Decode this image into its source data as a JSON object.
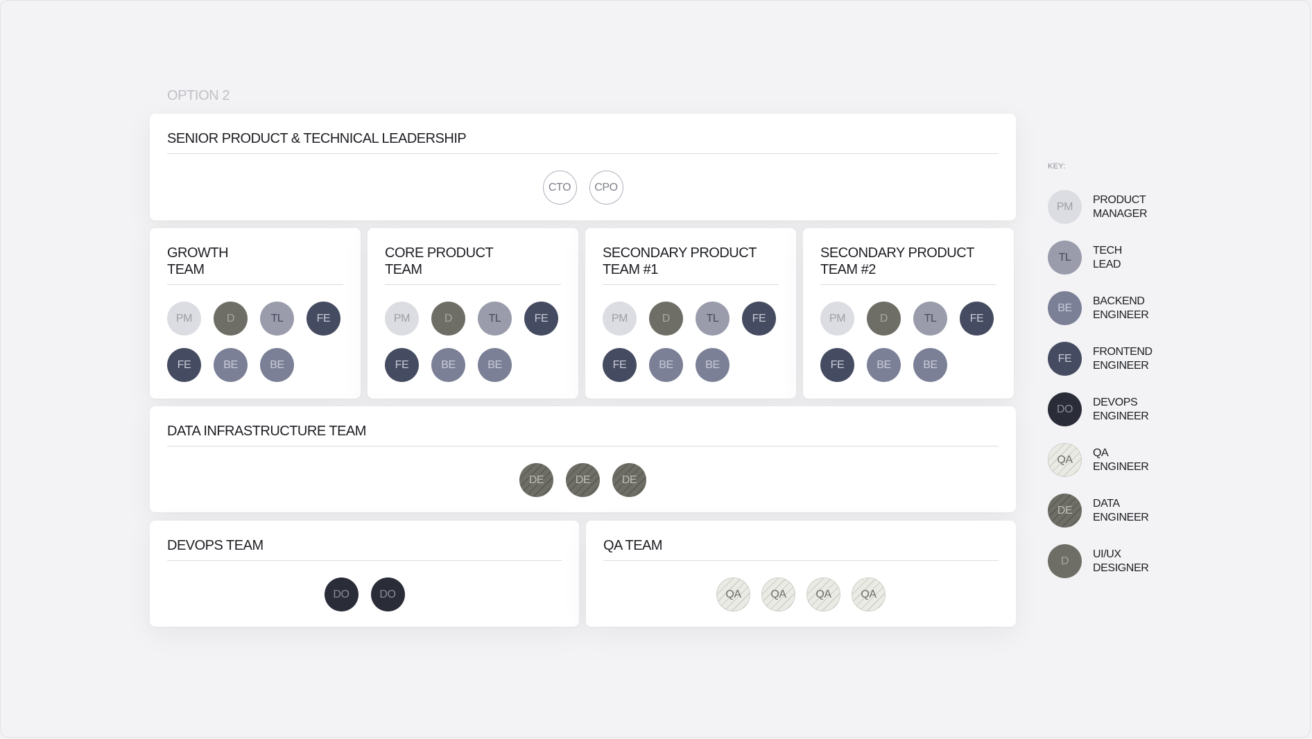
{
  "option_label": "OPTION 2",
  "leadership": {
    "title": "SENIOR PRODUCT & TECHNICAL LEADERSHIP",
    "members": [
      "CTO",
      "CPO"
    ]
  },
  "teams": [
    {
      "title": "GROWTH\nTEAM",
      "members": [
        {
          "role": "pm",
          "label": "PM"
        },
        {
          "role": "d",
          "label": "D"
        },
        {
          "role": "tl",
          "label": "TL"
        },
        {
          "role": "fe",
          "label": "FE"
        },
        {
          "role": "fe",
          "label": "FE"
        },
        {
          "role": "be",
          "label": "BE"
        },
        {
          "role": "be",
          "label": "BE"
        }
      ]
    },
    {
      "title": "CORE PRODUCT\nTEAM",
      "members": [
        {
          "role": "pm",
          "label": "PM"
        },
        {
          "role": "d",
          "label": "D"
        },
        {
          "role": "tl",
          "label": "TL"
        },
        {
          "role": "fe",
          "label": "FE"
        },
        {
          "role": "fe",
          "label": "FE"
        },
        {
          "role": "be",
          "label": "BE"
        },
        {
          "role": "be",
          "label": "BE"
        }
      ]
    },
    {
      "title": "SECONDARY PRODUCT\nTEAM #1",
      "members": [
        {
          "role": "pm",
          "label": "PM"
        },
        {
          "role": "d",
          "label": "D"
        },
        {
          "role": "tl",
          "label": "TL"
        },
        {
          "role": "fe",
          "label": "FE"
        },
        {
          "role": "fe",
          "label": "FE"
        },
        {
          "role": "be",
          "label": "BE"
        },
        {
          "role": "be",
          "label": "BE"
        }
      ]
    },
    {
      "title": "SECONDARY PRODUCT\nTEAM #2",
      "members": [
        {
          "role": "pm",
          "label": "PM"
        },
        {
          "role": "d",
          "label": "D"
        },
        {
          "role": "tl",
          "label": "TL"
        },
        {
          "role": "fe",
          "label": "FE"
        },
        {
          "role": "fe",
          "label": "FE"
        },
        {
          "role": "be",
          "label": "BE"
        },
        {
          "role": "be",
          "label": "BE"
        }
      ]
    }
  ],
  "data_infrastructure": {
    "title": "DATA INFRASTRUCTURE TEAM",
    "members": [
      "DE",
      "DE",
      "DE"
    ]
  },
  "devops": {
    "title": "DEVOPS TEAM",
    "members": [
      "DO",
      "DO"
    ]
  },
  "qa": {
    "title": "QA TEAM",
    "members": [
      "QA",
      "QA",
      "QA",
      "QA"
    ]
  },
  "key": {
    "title": "KEY:",
    "items": [
      {
        "role": "pm",
        "abbr": "PM",
        "label": "PRODUCT\nMANAGER"
      },
      {
        "role": "tl",
        "abbr": "TL",
        "label": "TECH\nLEAD"
      },
      {
        "role": "be",
        "abbr": "BE",
        "label": "BACKEND\nENGINEER"
      },
      {
        "role": "fe",
        "abbr": "FE",
        "label": "FRONTEND\nENGINEER"
      },
      {
        "role": "do",
        "abbr": "DO",
        "label": "DEVOPS\nENGINEER"
      },
      {
        "role": "qa",
        "abbr": "QA",
        "label": "QA\nENGINEER"
      },
      {
        "role": "de",
        "abbr": "DE",
        "label": "DATA\nENGINEER"
      },
      {
        "role": "d",
        "abbr": "D",
        "label": "UI/UX\nDESIGNER"
      }
    ]
  },
  "colors": {
    "background": "#f3f3f5",
    "card": "#ffffff",
    "product_manager": "#dcdde2",
    "designer": "#6e6e66",
    "tech_lead": "#9a9cac",
    "frontend_engineer": "#454b60",
    "backend_engineer": "#7b8096",
    "devops_engineer": "#2a2c38",
    "qa_engineer": "#ebebe6",
    "data_engineer": "#6e6e66"
  }
}
